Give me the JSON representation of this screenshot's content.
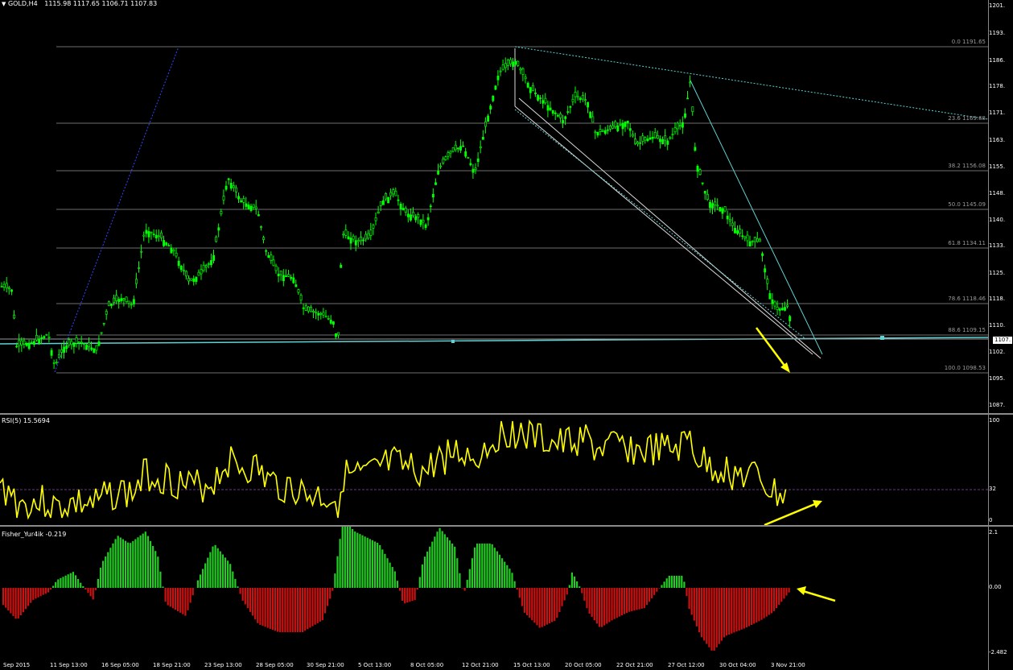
{
  "header": {
    "symbol": "GOLD,H4",
    "ohlc": "1115.98 1117.65 1106.71 1107.83",
    "dropdown_icon": "triangle-down-icon"
  },
  "main_axis": {
    "labels": [
      "1201.",
      "1193.",
      "1186.",
      "1178.",
      "1171.",
      "1163.",
      "1155.",
      "1148.",
      "1140.",
      "1133.",
      "1125.",
      "1118.",
      "1110.",
      "1102.",
      "1095.",
      "1087."
    ],
    "current_price": "1107."
  },
  "fibo": [
    {
      "label": "0.0  1191.65"
    },
    {
      "label": "23.6  1169.68"
    },
    {
      "label": "38.2  1156.08"
    },
    {
      "label": "50.0  1145.09"
    },
    {
      "label": "61.8  1134.11"
    },
    {
      "label": "78.6  1118.46"
    },
    {
      "label": "88.6  1109.15"
    },
    {
      "label": "100.0  1098.53"
    }
  ],
  "rsi": {
    "title": "RSI(5) 15.5694",
    "levels": [
      "100",
      "32",
      "0"
    ],
    "color": "#ffff00"
  },
  "fisher": {
    "title": "Fisher_Yur4ik -0.219",
    "levels": [
      "2.1",
      "0.00",
      "-2.482"
    ],
    "pos_color": "#22cc22",
    "neg_color": "#cc1111"
  },
  "time_axis": [
    "Sep 2015",
    "11 Sep 13:00",
    "16 Sep 05:00",
    "18 Sep 21:00",
    "23 Sep 13:00",
    "28 Sep 05:00",
    "30 Sep 21:00",
    "5 Oct 13:00",
    "8 Oct 05:00",
    "12 Oct 21:00",
    "15 Oct 13:00",
    "20 Oct 05:00",
    "22 Oct 21:00",
    "27 Oct 12:00",
    "30 Oct 04:00",
    "3 Nov 21:00"
  ],
  "colors": {
    "candle": "#00ff00",
    "hline": "#5fd3d3",
    "arrow": "#ffff00",
    "grid": "#6e6e6e"
  }
}
